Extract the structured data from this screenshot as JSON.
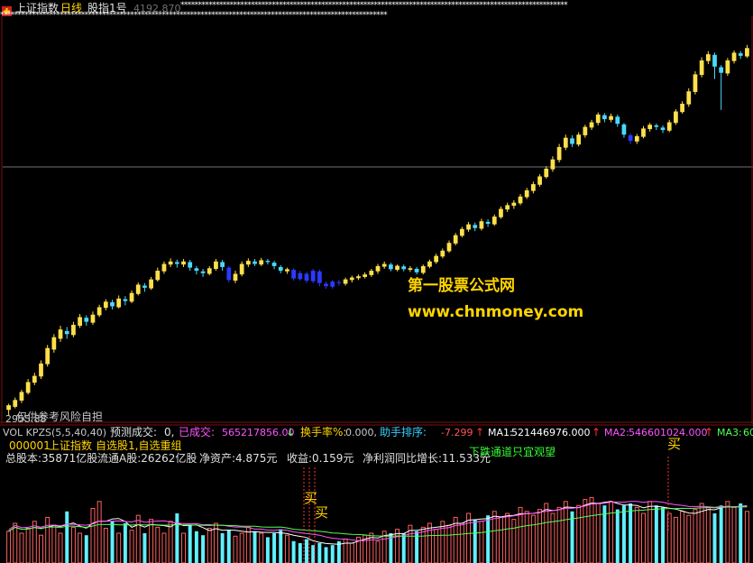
{
  "colors": {
    "background": "#000000",
    "candle_up": "#ffe04a",
    "candle_down": "#4ad8ff",
    "candle_special_down": "#2a3aff",
    "vol_up": "#ff6060",
    "vol_down": "#60f0ff",
    "grid": "#7a1010",
    "hline": "#707070",
    "ma1": "#ffffff",
    "ma2": "#ff55ff",
    "ma3": "#55ff55",
    "accent_red": "#ff3333",
    "accent_yellow": "#ffd400",
    "accent_green": "#33ff33"
  },
  "header": {
    "title": "上证指数",
    "period": "日线",
    "formula": "股指1号",
    "price": "4192.870",
    "star_strip": "**************************************************************************************************************"
  },
  "watermark": {
    "line1": "第一股票公式网",
    "line2": "www.chnmoney.com"
  },
  "disclaimer": {
    "low_value": "2955.88",
    "text_a": "仅供参考",
    "text_b": "风险自担"
  },
  "indicator_bar": {
    "name": "VOL KPZS(5,5,40,40)",
    "forecast_label": "预测成交:",
    "forecast_value": "0,",
    "done_label": "已成交:",
    "done_value": "565217856.00",
    "turnover_label": "换手率%:",
    "turnover_value": "0.000,",
    "rank_label": "助手排序:",
    "rank_value": "-7.299",
    "ma1_label": "MA1:",
    "ma1_value": "521446976.000",
    "ma2_label": "MA2:",
    "ma2_value": "546601024.000",
    "ma3_label": "MA3:",
    "ma3_value": "60"
  },
  "info_panel": {
    "code": "000001",
    "name": "上证指数",
    "sector": "自选股1,自选重组",
    "total_shares": "总股本:35871亿股",
    "float_shares": "流通A股:26262亿股",
    "net_assets": "净资产:4.875元",
    "earnings": "收益:0.159元",
    "profit_growth": "净利润同比增长:11.533元",
    "green_notice": "下跌通道只宜观望"
  },
  "signals": {
    "buy_1": "买",
    "buy_2": "买",
    "buy_3": "买"
  },
  "chart_data": {
    "type": "candlestick",
    "title": "上证指数 日线",
    "price_range": [
      2955.88,
      4192.87
    ],
    "candles": [
      [
        2990,
        3005,
        2970,
        3010,
        "up"
      ],
      [
        3000,
        3022,
        2995,
        3030,
        "up"
      ],
      [
        3020,
        3048,
        3012,
        3055,
        "up"
      ],
      [
        3045,
        3080,
        3040,
        3090,
        "up"
      ],
      [
        3078,
        3100,
        3070,
        3110,
        "up"
      ],
      [
        3098,
        3140,
        3090,
        3150,
        "up"
      ],
      [
        3138,
        3190,
        3130,
        3200,
        "up"
      ],
      [
        3185,
        3225,
        3175,
        3235,
        "up"
      ],
      [
        3220,
        3250,
        3210,
        3262,
        "up"
      ],
      [
        3245,
        3235,
        3220,
        3258,
        "down"
      ],
      [
        3232,
        3265,
        3225,
        3275,
        "up"
      ],
      [
        3262,
        3290,
        3255,
        3300,
        "up"
      ],
      [
        3288,
        3275,
        3262,
        3296,
        "down"
      ],
      [
        3272,
        3298,
        3265,
        3308,
        "up"
      ],
      [
        3296,
        3322,
        3290,
        3330,
        "up"
      ],
      [
        3320,
        3340,
        3312,
        3348,
        "up"
      ],
      [
        3338,
        3325,
        3315,
        3346,
        "down"
      ],
      [
        3322,
        3350,
        3318,
        3360,
        "up"
      ],
      [
        3348,
        3342,
        3328,
        3358,
        "down"
      ],
      [
        3340,
        3368,
        3335,
        3376,
        "up"
      ],
      [
        3365,
        3395,
        3360,
        3402,
        "up"
      ],
      [
        3392,
        3385,
        3372,
        3400,
        "down"
      ],
      [
        3383,
        3412,
        3378,
        3420,
        "up"
      ],
      [
        3410,
        3440,
        3405,
        3450,
        "up"
      ],
      [
        3438,
        3462,
        3430,
        3470,
        "up"
      ],
      [
        3460,
        3470,
        3452,
        3480,
        "up"
      ],
      [
        3468,
        3462,
        3450,
        3476,
        "down"
      ],
      [
        3460,
        3470,
        3452,
        3478,
        "up"
      ],
      [
        3468,
        3450,
        3440,
        3475,
        "down"
      ],
      [
        3448,
        3440,
        3428,
        3455,
        "down"
      ],
      [
        3438,
        3432,
        3420,
        3446,
        "down"
      ],
      [
        3430,
        3448,
        3425,
        3455,
        "up"
      ],
      [
        3446,
        3470,
        3440,
        3478,
        "up"
      ],
      [
        3468,
        3452,
        3440,
        3475,
        "down"
      ],
      [
        3450,
        3410,
        3402,
        3455,
        "blue"
      ],
      [
        3408,
        3430,
        3400,
        3440,
        "up"
      ],
      [
        3428,
        3462,
        3422,
        3470,
        "up"
      ],
      [
        3460,
        3472,
        3452,
        3480,
        "up"
      ],
      [
        3470,
        3462,
        3455,
        3478,
        "down"
      ],
      [
        3460,
        3474,
        3455,
        3482,
        "up"
      ],
      [
        3472,
        3468,
        3460,
        3478,
        "down"
      ],
      [
        3466,
        3455,
        3445,
        3472,
        "down"
      ],
      [
        3452,
        3440,
        3432,
        3458,
        "down"
      ],
      [
        3438,
        3445,
        3430,
        3450,
        "up"
      ],
      [
        3443,
        3415,
        3408,
        3448,
        "blue"
      ],
      [
        3413,
        3432,
        3408,
        3440,
        "blue"
      ],
      [
        3430,
        3408,
        3400,
        3436,
        "blue"
      ],
      [
        3406,
        3440,
        3400,
        3446,
        "blue"
      ],
      [
        3438,
        3400,
        3390,
        3444,
        "blue"
      ],
      [
        3398,
        3390,
        3382,
        3405,
        "blue"
      ],
      [
        3388,
        3405,
        3382,
        3410,
        "blue"
      ],
      [
        3403,
        3400,
        3392,
        3410,
        "blue"
      ],
      [
        3398,
        3412,
        3392,
        3418,
        "up"
      ],
      [
        3410,
        3418,
        3402,
        3424,
        "up"
      ],
      [
        3416,
        3422,
        3410,
        3428,
        "up"
      ],
      [
        3420,
        3428,
        3415,
        3435,
        "up"
      ],
      [
        3426,
        3440,
        3420,
        3446,
        "up"
      ],
      [
        3438,
        3455,
        3430,
        3462,
        "up"
      ],
      [
        3453,
        3462,
        3446,
        3470,
        "up"
      ],
      [
        3460,
        3445,
        3438,
        3466,
        "down"
      ],
      [
        3443,
        3456,
        3438,
        3460,
        "up"
      ],
      [
        3454,
        3445,
        3438,
        3460,
        "down"
      ],
      [
        3443,
        3448,
        3436,
        3455,
        "up"
      ],
      [
        3446,
        3435,
        3428,
        3452,
        "down"
      ],
      [
        3433,
        3455,
        3428,
        3460,
        "up"
      ],
      [
        3453,
        3470,
        3448,
        3476,
        "up"
      ],
      [
        3468,
        3488,
        3462,
        3495,
        "up"
      ],
      [
        3486,
        3505,
        3480,
        3512,
        "up"
      ],
      [
        3503,
        3530,
        3498,
        3538,
        "up"
      ],
      [
        3528,
        3555,
        3522,
        3562,
        "up"
      ],
      [
        3553,
        3575,
        3548,
        3582,
        "up"
      ],
      [
        3573,
        3590,
        3566,
        3598,
        "up"
      ],
      [
        3588,
        3578,
        3568,
        3596,
        "down"
      ],
      [
        3576,
        3600,
        3570,
        3608,
        "up"
      ],
      [
        3598,
        3592,
        3582,
        3606,
        "down"
      ],
      [
        3590,
        3615,
        3585,
        3622,
        "up"
      ],
      [
        3613,
        3640,
        3608,
        3648,
        "up"
      ],
      [
        3638,
        3652,
        3630,
        3660,
        "up"
      ],
      [
        3650,
        3660,
        3640,
        3668,
        "up"
      ],
      [
        3658,
        3680,
        3652,
        3688,
        "up"
      ],
      [
        3678,
        3700,
        3672,
        3708,
        "up"
      ],
      [
        3698,
        3720,
        3690,
        3728,
        "up"
      ],
      [
        3718,
        3745,
        3712,
        3752,
        "up"
      ],
      [
        3743,
        3770,
        3738,
        3778,
        "up"
      ],
      [
        3768,
        3800,
        3760,
        3810,
        "up"
      ],
      [
        3798,
        3840,
        3790,
        3850,
        "up"
      ],
      [
        3838,
        3870,
        3830,
        3880,
        "up"
      ],
      [
        3868,
        3850,
        3840,
        3878,
        "down"
      ],
      [
        3848,
        3880,
        3842,
        3888,
        "up"
      ],
      [
        3878,
        3905,
        3870,
        3912,
        "up"
      ],
      [
        3903,
        3920,
        3895,
        3928,
        "up"
      ],
      [
        3918,
        3945,
        3910,
        3952,
        "up"
      ],
      [
        3943,
        3930,
        3920,
        3950,
        "down"
      ],
      [
        3928,
        3940,
        3920,
        3948,
        "up"
      ],
      [
        3938,
        3915,
        3905,
        3945,
        "down"
      ],
      [
        3913,
        3880,
        3870,
        3918,
        "down"
      ],
      [
        3878,
        3860,
        3850,
        3884,
        "blue"
      ],
      [
        3858,
        3875,
        3850,
        3882,
        "up"
      ],
      [
        3873,
        3900,
        3868,
        3908,
        "up"
      ],
      [
        3898,
        3912,
        3890,
        3918,
        "up"
      ],
      [
        3910,
        3905,
        3895,
        3916,
        "down"
      ],
      [
        3903,
        3895,
        3885,
        3910,
        "down"
      ],
      [
        3893,
        3920,
        3888,
        3928,
        "up"
      ],
      [
        3918,
        3955,
        3912,
        3962,
        "up"
      ],
      [
        3953,
        3980,
        3948,
        3988,
        "up"
      ],
      [
        3978,
        4020,
        3970,
        4030,
        "up"
      ],
      [
        4018,
        4075,
        4010,
        4085,
        "up"
      ],
      [
        4073,
        4120,
        4065,
        4130,
        "up"
      ],
      [
        4118,
        4140,
        4108,
        4150,
        "up"
      ],
      [
        4138,
        4100,
        4060,
        4145,
        "down"
      ],
      [
        4098,
        4080,
        3960,
        4105,
        "down"
      ],
      [
        4078,
        4120,
        4070,
        4128,
        "up"
      ],
      [
        4118,
        4145,
        4110,
        4152,
        "up"
      ],
      [
        4143,
        4135,
        4125,
        4150,
        "down"
      ],
      [
        4133,
        4160,
        4128,
        4170,
        "up"
      ]
    ],
    "volume_relative": [
      0.32,
      0.4,
      0.3,
      0.35,
      0.42,
      0.28,
      0.46,
      0.38,
      0.3,
      0.52,
      0.36,
      0.3,
      0.28,
      0.55,
      0.62,
      0.35,
      0.42,
      0.3,
      0.4,
      0.33,
      0.48,
      0.3,
      0.44,
      0.36,
      0.3,
      0.42,
      0.5,
      0.3,
      0.38,
      0.32,
      0.28,
      0.35,
      0.4,
      0.3,
      0.33,
      0.27,
      0.3,
      0.36,
      0.32,
      0.3,
      0.26,
      0.3,
      0.34,
      0.28,
      0.22,
      0.2,
      0.24,
      0.18,
      0.2,
      0.16,
      0.18,
      0.22,
      0.24,
      0.2,
      0.26,
      0.28,
      0.3,
      0.22,
      0.32,
      0.3,
      0.34,
      0.3,
      0.38,
      0.32,
      0.36,
      0.4,
      0.34,
      0.42,
      0.38,
      0.46,
      0.4,
      0.5,
      0.44,
      0.42,
      0.48,
      0.52,
      0.46,
      0.5,
      0.44,
      0.56,
      0.52,
      0.48,
      0.54,
      0.6,
      0.5,
      0.56,
      0.62,
      0.52,
      0.58,
      0.64,
      0.66,
      0.6,
      0.58,
      0.62,
      0.54,
      0.58,
      0.6,
      0.56,
      0.5,
      0.62,
      0.58,
      0.56,
      0.5,
      0.46,
      0.52,
      0.48,
      0.54,
      0.6,
      0.56,
      0.5,
      0.58,
      0.62,
      0.56,
      0.6,
      0.52
    ]
  }
}
